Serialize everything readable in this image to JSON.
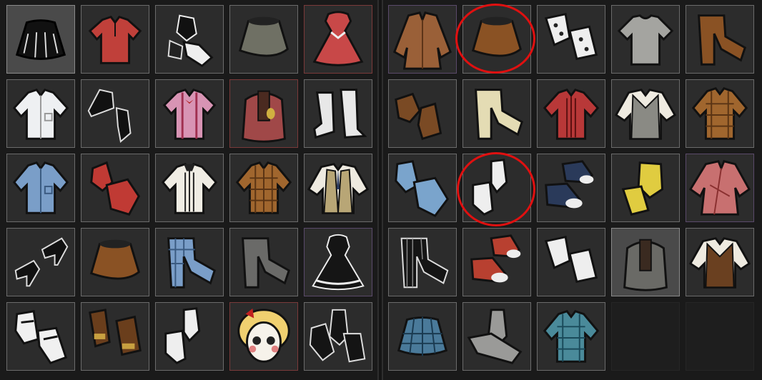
{
  "colors": {
    "highlight": "#e01010",
    "slot_bg": "#2c2c2c",
    "slot_border": "#6b6b6b"
  },
  "left_items": [
    "black-skirt-icon",
    "red-polo-shirt-icon",
    "black-white-gloves-icon",
    "gray-skirt-icon",
    "red-dress-icon",
    "white-shirt-icon",
    "black-shoes-icon",
    "pink-suspender-shirt-icon",
    "red-backpack-icon",
    "white-boots-icon",
    "blue-shirt-icon",
    "red-gloves-icon",
    "white-ruffle-shirt-icon",
    "plaid-jacket-icon",
    "tan-vest-icon",
    "black-heels-icon",
    "brown-skirt-icon",
    "blue-plaid-pants-icon",
    "gray-pants-icon",
    "black-frilly-dress-icon",
    "white-mary-janes-icon",
    "brown-gloves-icon",
    "white-heels-icon",
    "wendy-portrait-icon",
    "black-long-gloves-icon"
  ],
  "right_items": [
    "brown-coat-icon",
    "brown-skirt-icon",
    "white-spotted-gloves-icon",
    "gray-tshirt-icon",
    "brown-pants-icon",
    "brown-boots-icon",
    "cream-pants-icon",
    "red-ruffle-shirt-icon",
    "sweater-vest-icon",
    "plaid-shirt-icon",
    "blue-gloves-icon",
    "white-heels-icon",
    "blue-sneakers-icon",
    "yellow-gloves-icon",
    "pink-kimono-icon",
    "black-striped-pants-icon",
    "red-sneakers-icon",
    "white-gloves-icon",
    "gray-backpack-icon",
    "brown-vest-icon",
    "blue-plaid-skirt-icon",
    "gray-long-gloves-icon",
    "teal-plaid-shirt-icon",
    "empty-slot",
    "empty-slot"
  ]
}
